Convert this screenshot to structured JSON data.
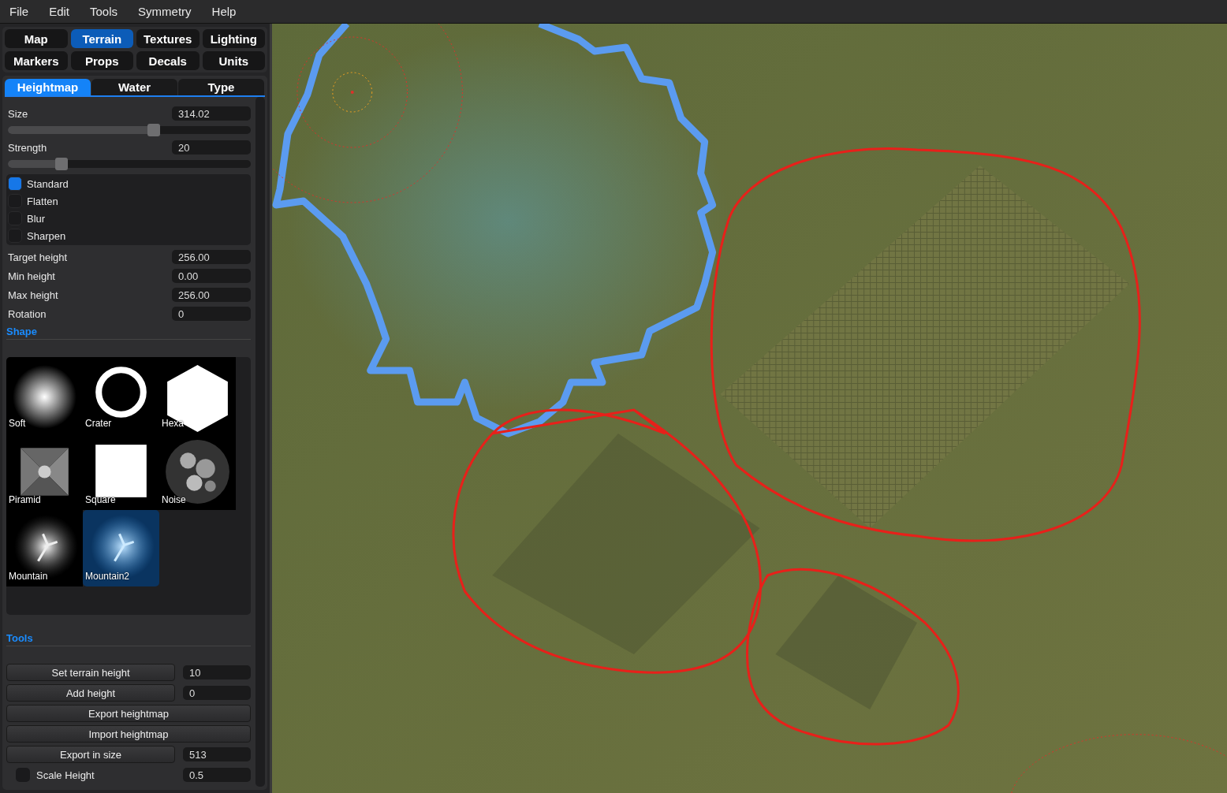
{
  "menu": [
    "File",
    "Edit",
    "Tools",
    "Symmetry",
    "Help"
  ],
  "editor_tabs": [
    {
      "label": "Map",
      "selected": false
    },
    {
      "label": "Terrain",
      "selected": true
    },
    {
      "label": "Textures",
      "selected": false
    },
    {
      "label": "Lighting",
      "selected": false
    },
    {
      "label": "Markers",
      "selected": false
    },
    {
      "label": "Props",
      "selected": false
    },
    {
      "label": "Decals",
      "selected": false
    },
    {
      "label": "Units",
      "selected": false
    }
  ],
  "sub_tabs": [
    {
      "label": "Heightmap",
      "selected": true
    },
    {
      "label": "Water",
      "selected": false
    },
    {
      "label": "Type",
      "selected": false
    }
  ],
  "sliders": [
    {
      "label": "Size",
      "value": "314.02",
      "level": 0.6
    },
    {
      "label": "Strength",
      "value": "20",
      "level": 0.22
    }
  ],
  "brush_modes": [
    {
      "label": "Standard",
      "selected": true
    },
    {
      "label": "Flatten",
      "selected": false
    },
    {
      "label": "Blur",
      "selected": false
    },
    {
      "label": "Sharpen",
      "selected": false
    }
  ],
  "fields": [
    {
      "label": "Target height",
      "value": "256.00"
    },
    {
      "label": "Min height",
      "value": "0.00"
    },
    {
      "label": "Max height",
      "value": "256.00"
    },
    {
      "label": "Rotation",
      "value": "0"
    }
  ],
  "shape_title": "Shape",
  "brushes": [
    {
      "label": "Soft",
      "kind": "soft",
      "selected": false
    },
    {
      "label": "Crater",
      "kind": "crater",
      "selected": false
    },
    {
      "label": "Hexa",
      "kind": "hexa",
      "selected": false
    },
    {
      "label": "Piramid",
      "kind": "piramid",
      "selected": false
    },
    {
      "label": "Square",
      "kind": "square",
      "selected": false
    },
    {
      "label": "Noise",
      "kind": "noise",
      "selected": false
    },
    {
      "label": "Mountain",
      "kind": "mountain",
      "selected": false
    },
    {
      "label": "Mountain2",
      "kind": "mountain",
      "selected": true
    }
  ],
  "tools_title": "Tools",
  "tools": [
    {
      "kind": "button_field",
      "label": "Set terrain height",
      "value": "10"
    },
    {
      "kind": "button_field",
      "label": "Add height",
      "value": "0"
    },
    {
      "kind": "button",
      "label": "Export heightmap"
    },
    {
      "kind": "button",
      "label": "Import heightmap"
    },
    {
      "kind": "button_field",
      "label": "Export in size",
      "value": "513"
    },
    {
      "kind": "checkbox_field",
      "label": "Scale Height",
      "checked": false,
      "value": "0.5"
    }
  ]
}
